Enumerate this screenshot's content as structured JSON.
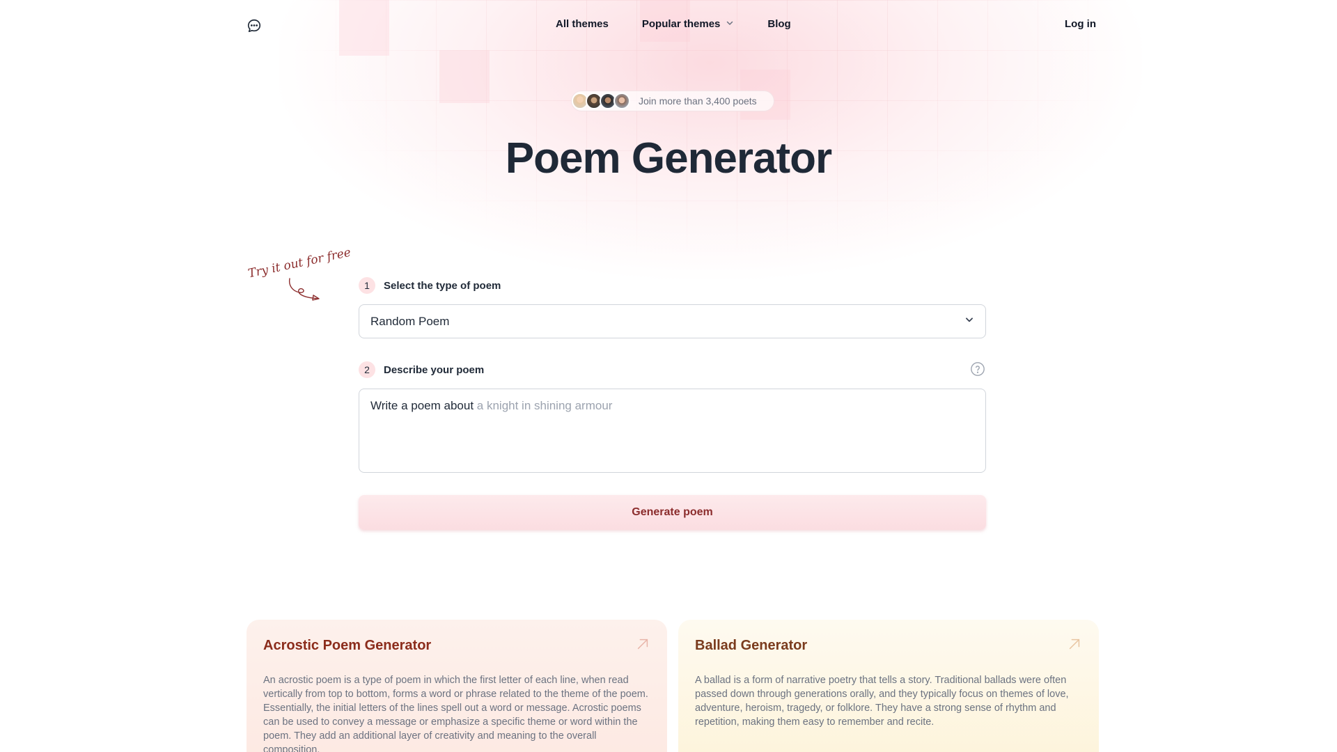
{
  "nav": {
    "logo_icon": "chat-bubble-icon",
    "links": [
      {
        "label": "All themes"
      },
      {
        "label": "Popular themes",
        "icon": "chevron-down-icon"
      },
      {
        "label": "Blog"
      }
    ],
    "login_label": "Log in"
  },
  "hero": {
    "social_proof": "Join more than 3,400 poets",
    "title": "Poem Generator"
  },
  "note": {
    "text": "Try it out for free"
  },
  "form": {
    "step1": {
      "number": "1",
      "label": "Select the type of poem"
    },
    "select_value": "Random Poem",
    "step2": {
      "number": "2",
      "label": "Describe your poem"
    },
    "textarea_prefix": "Write a poem about",
    "textarea_placeholder": "a knight in shining armour",
    "generate_label": "Generate poem"
  },
  "cards": [
    {
      "title": "Acrostic Poem Generator",
      "description": "An acrostic poem is a type of poem in which the first letter of each line, when read vertically from top to bottom, forms a word or phrase related to the theme of the poem. Essentially, the initial letters of the lines spell out a word or message. Acrostic poems can be used to convey a message or emphasize a specific theme or word within the poem. They add an additional layer of creativity and meaning to the overall composition."
    },
    {
      "title": "Ballad Generator",
      "description": "A ballad is a form of narrative poetry that tells a story. Traditional ballads were often passed down through generations orally, and they typically focus on themes of love, adventure, heroism, tragedy, or folklore. They have a strong sense of rhythm and repetition, making them easy to remember and recite."
    }
  ],
  "colors": {
    "accent": "#8b2c2c",
    "step_badge": "#fde2e4",
    "button_bg": "#fbdde1"
  }
}
